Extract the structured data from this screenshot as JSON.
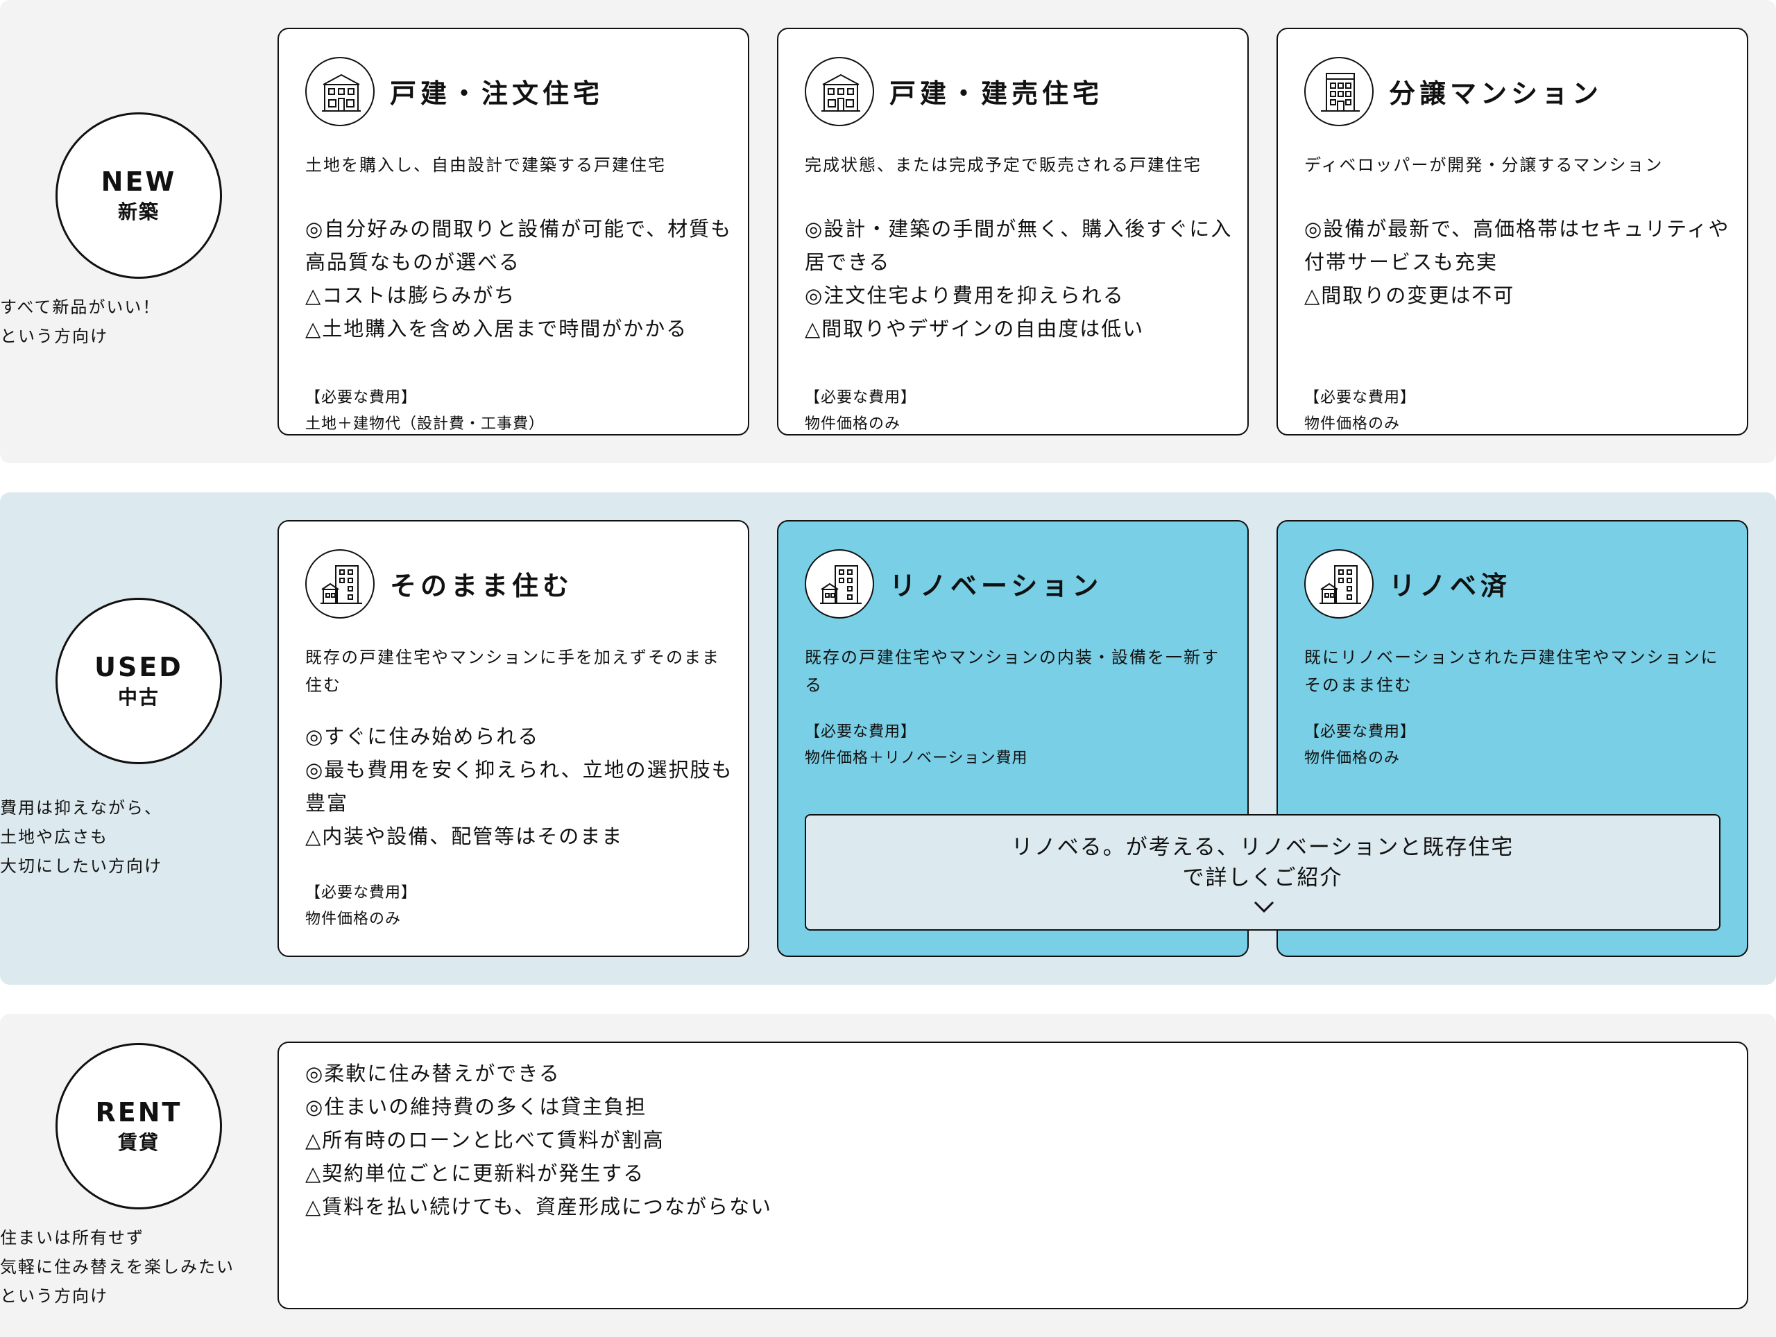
{
  "new": {
    "category": {
      "en": "NEW",
      "ja": "新築",
      "desc": [
        "すべて新品がいい！",
        "という方向け"
      ]
    },
    "cards": [
      {
        "icon": "house-icon",
        "title": "戸建・注文住宅",
        "sub": "土地を購入し、自由設計で建築する戸建住宅",
        "points": [
          "◎自分好みの間取りと設備が可能で、材質も高品質なものが選べる",
          "△コストは膨らみがち",
          "△土地購入を含め入居まで時間がかかる"
        ],
        "cost_label": "【必要な費用】",
        "cost_value": "土地＋建物代（設計費・工事費）"
      },
      {
        "icon": "house-icon",
        "title": "戸建・建売住宅",
        "sub": "完成状態、または完成予定で販売される戸建住宅",
        "points": [
          "◎設計・建築の手間が無く、購入後すぐに入居できる",
          "◎注文住宅より費用を抑えられる",
          "△間取りやデザインの自由度は低い"
        ],
        "cost_label": "【必要な費用】",
        "cost_value": "物件価格のみ"
      },
      {
        "icon": "apartment-building-icon",
        "title": "分譲マンション",
        "sub": "ディベロッパーが開発・分譲するマンション",
        "points": [
          "◎設備が最新で、高価格帯はセキュリティや付帯サービスも充実",
          "△間取りの変更は不可"
        ],
        "cost_label": "【必要な費用】",
        "cost_value": "物件価格のみ"
      }
    ]
  },
  "used": {
    "category": {
      "en": "USED",
      "ja": "中古",
      "desc": [
        "費用は抑えながら、",
        "土地や広さも",
        "大切にしたい方向け"
      ]
    },
    "cards": [
      {
        "icon": "buildings-icon",
        "title": "そのまま住む",
        "sub": "既存の戸建住宅やマンションに手を加えずそのまま住む",
        "points": [
          "◎すぐに住み始められる",
          "◎最も費用を安く抑えられ、立地の選択肢も豊富",
          "△内装や設備、配管等はそのまま"
        ],
        "cost_label": "【必要な費用】",
        "cost_value": "物件価格のみ"
      },
      {
        "icon": "buildings-icon",
        "title": "リノベーション",
        "sub": "既存の戸建住宅やマンションの内装・設備を一新する",
        "cost_label": "【必要な費用】",
        "cost_value": "物件価格＋リノベーション費用"
      },
      {
        "icon": "buildings-icon",
        "title": "リノベ済",
        "sub": "既にリノベーションされた戸建住宅やマンションにそのまま住む",
        "cost_label": "【必要な費用】",
        "cost_value": "物件価格のみ"
      }
    ],
    "cta": {
      "line1": "リノベる。が考える、リノベーションと既存住宅",
      "line2": "で詳しくご紹介",
      "icon": "chevron-down-icon"
    }
  },
  "rent": {
    "category": {
      "en": "RENT",
      "ja": "賃貸",
      "desc": [
        "住まいは所有せず",
        "気軽に住み替えを楽しみたい",
        "という方向け"
      ]
    },
    "points": [
      "◎柔軟に住み替えができる",
      "◎住まいの維持費の多くは貸主負担",
      "△所有時のローンと比べて賃料が割高",
      "△契約単位ごとに更新料が発生する",
      "△賃料を払い続けても、資産形成につながらない"
    ]
  },
  "colors": {
    "section_gray": "#f3f3f3",
    "section_blue": "#dce9ee",
    "card_accent": "#79cfe5"
  }
}
